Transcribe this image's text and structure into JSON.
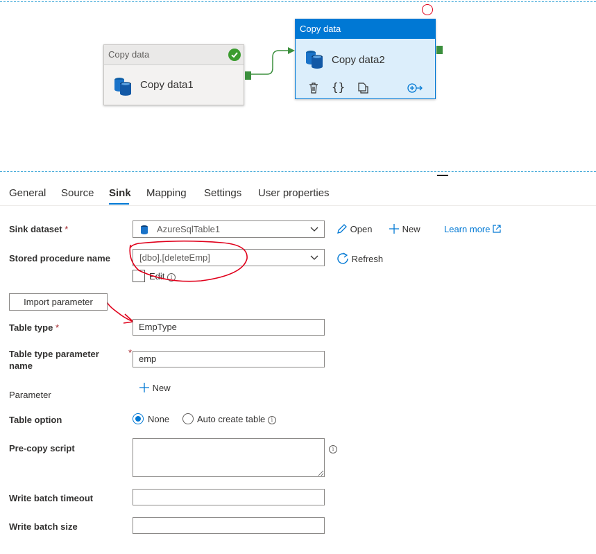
{
  "canvas": {
    "activity1": {
      "type_label": "Copy data",
      "name": "Copy data1"
    },
    "activity2": {
      "type_label": "Copy data",
      "name": "Copy data2"
    }
  },
  "tabs": [
    {
      "label": "General",
      "active": false
    },
    {
      "label": "Source",
      "active": false
    },
    {
      "label": "Sink",
      "active": true
    },
    {
      "label": "Mapping",
      "active": false
    },
    {
      "label": "Settings",
      "active": false
    },
    {
      "label": "User properties",
      "active": false
    }
  ],
  "form": {
    "sink_dataset": {
      "label": "Sink dataset",
      "required_mark": "*",
      "value": "AzureSqlTable1",
      "open_label": "Open",
      "new_label": "New",
      "learn_more_label": "Learn more"
    },
    "stored_procedure": {
      "label": "Stored procedure name",
      "value": "[dbo].[deleteEmp]",
      "refresh_label": "Refresh",
      "edit_label": "Edit"
    },
    "import_parameter_label": "Import parameter",
    "table_type": {
      "label": "Table type",
      "required_mark": "*",
      "value": "EmpType"
    },
    "table_type_param": {
      "label_line1": "Table type parameter",
      "label_line2": "name",
      "required_mark": "*",
      "value": "emp"
    },
    "parameter": {
      "label": "Parameter",
      "new_label": "New"
    },
    "table_option": {
      "label": "Table option",
      "none_label": "None",
      "auto_label": "Auto create table",
      "selected": "None"
    },
    "pre_copy_script": {
      "label": "Pre-copy script",
      "value": ""
    },
    "write_batch_timeout": {
      "label": "Write batch timeout",
      "value": ""
    },
    "write_batch_size": {
      "label": "Write batch size",
      "value": ""
    }
  },
  "colors": {
    "accent": "#0078d4",
    "success": "#3b9c2f",
    "annotation": "#e0001b"
  }
}
